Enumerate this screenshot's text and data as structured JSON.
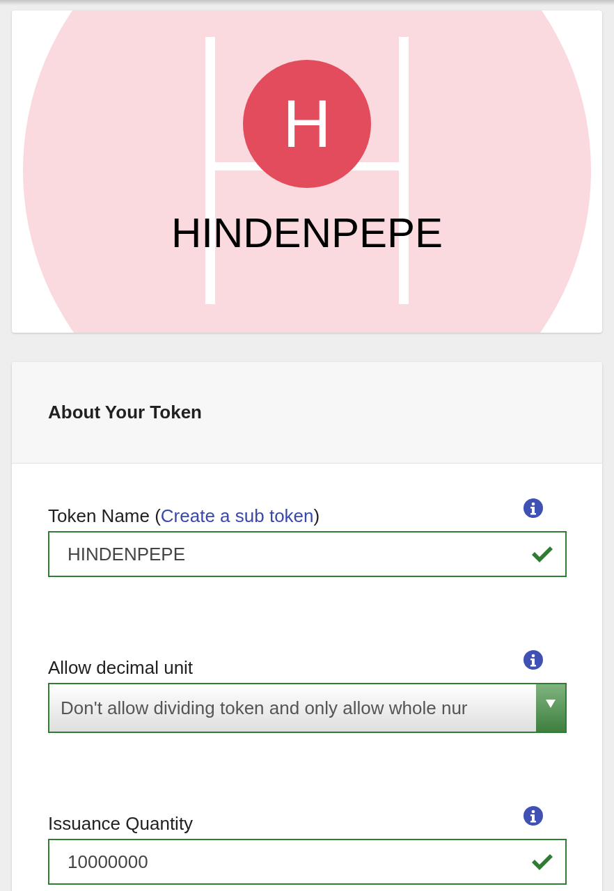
{
  "token_card": {
    "logo_letter": "H",
    "name": "HINDENPEPE"
  },
  "form": {
    "title": "About Your Token",
    "fields": [
      {
        "kind": "text",
        "label": "Token Name (",
        "link": "Create a sub token",
        "label_after": ")",
        "value": "HINDENPEPE",
        "valid": true
      },
      {
        "kind": "select",
        "label": "Allow decimal unit",
        "value": "Don't allow dividing token and only allow whole nur",
        "valid": true
      },
      {
        "kind": "text",
        "label": "Issuance Quantity",
        "value": "10000000",
        "valid": true
      }
    ]
  }
}
